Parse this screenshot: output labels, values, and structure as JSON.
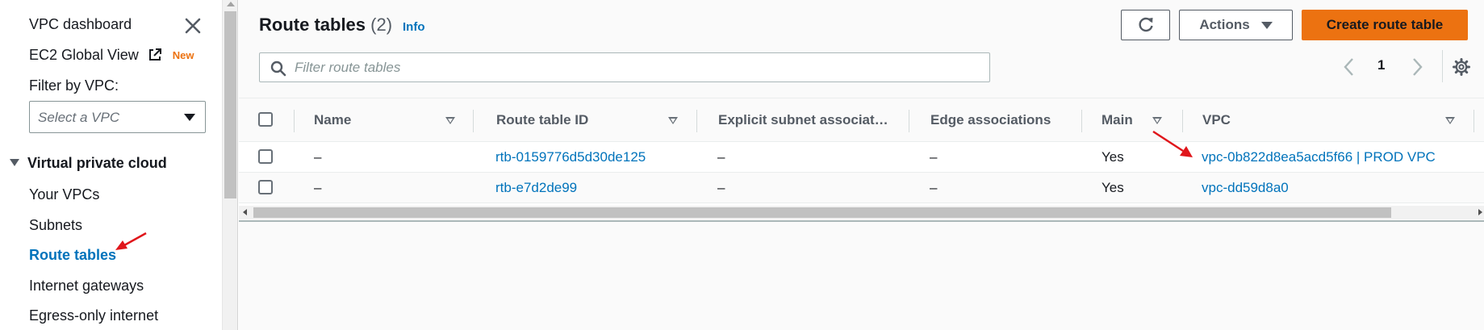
{
  "sidebar": {
    "vpc_dashboard": "VPC dashboard",
    "ec2_global_view": "EC2 Global View",
    "new_badge": "New",
    "filter_by_vpc_label": "Filter by VPC:",
    "select_vpc_placeholder": "Select a VPC",
    "section_title": "Virtual private cloud",
    "items": [
      {
        "label": "Your VPCs"
      },
      {
        "label": "Subnets"
      },
      {
        "label": "Route tables",
        "active": true
      },
      {
        "label": "Internet gateways"
      },
      {
        "label": "Egress-only internet"
      }
    ]
  },
  "header": {
    "title": "Route tables",
    "count": "(2)",
    "info_link": "Info",
    "actions_label": "Actions",
    "create_label": "Create route table"
  },
  "filter": {
    "placeholder": "Filter route tables"
  },
  "pagination": {
    "current_page": "1"
  },
  "table": {
    "columns": [
      "Name",
      "Route table ID",
      "Explicit subnet associat…",
      "Edge associations",
      "Main",
      "VPC"
    ],
    "rows": [
      {
        "name": "–",
        "route_table_id": "rtb-0159776d5d30de125",
        "explicit_subnet": "–",
        "edge": "–",
        "main": "Yes",
        "vpc": "vpc-0b822d8ea5acd5f66 | PROD VPC"
      },
      {
        "name": "–",
        "route_table_id": "rtb-e7d2de99",
        "explicit_subnet": "–",
        "edge": "–",
        "main": "Yes",
        "vpc": "vpc-dd59d8a0"
      }
    ]
  },
  "colors": {
    "link": "#0073bb",
    "primary_button": "#ec7211",
    "annotation_arrow": "#e0161b"
  }
}
